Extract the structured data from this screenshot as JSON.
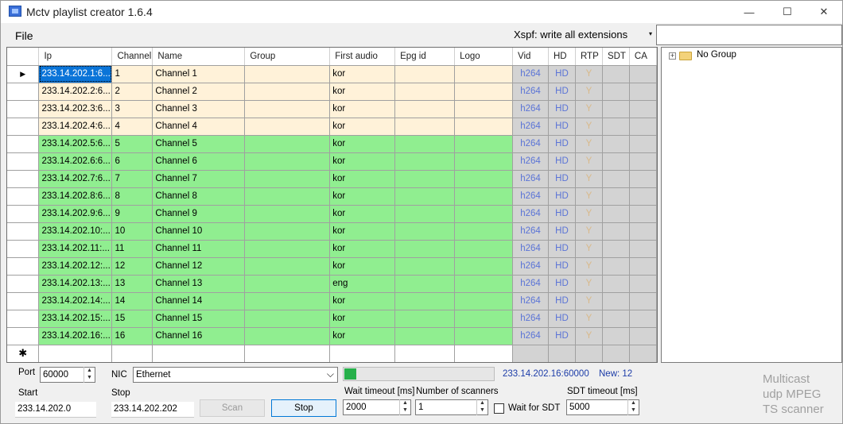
{
  "window": {
    "title": "Mctv playlist creator 1.6.4",
    "minimize_glyph": "—",
    "maximize_glyph": "☐",
    "close_glyph": "✕"
  },
  "menu": {
    "file": "File"
  },
  "toolbar": {
    "extension_option": "Xspf: write all extensions",
    "dropdown_glyph": "▾",
    "text_value": ""
  },
  "grid": {
    "columns": [
      "Ip",
      "Channel",
      "Name",
      "Group",
      "First audio",
      "Epg id",
      "Logo",
      "Vid",
      "HD",
      "RTP",
      "SDT",
      "CA"
    ],
    "current_row_marker": "▶",
    "new_row_marker": "✱",
    "rows": [
      {
        "ip": "233.14.202.1:6...",
        "channel": "1",
        "name": "Channel 1",
        "group": "",
        "audio": "kor",
        "epg": "",
        "logo": "",
        "vid": "h264",
        "hd": "HD",
        "rtp": "Y",
        "sdt": "",
        "ca": "",
        "state": "cream"
      },
      {
        "ip": "233.14.202.2:6...",
        "channel": "2",
        "name": "Channel 2",
        "group": "",
        "audio": "kor",
        "epg": "",
        "logo": "",
        "vid": "h264",
        "hd": "HD",
        "rtp": "Y",
        "sdt": "",
        "ca": "",
        "state": "cream"
      },
      {
        "ip": "233.14.202.3:6...",
        "channel": "3",
        "name": "Channel 3",
        "group": "",
        "audio": "kor",
        "epg": "",
        "logo": "",
        "vid": "h264",
        "hd": "HD",
        "rtp": "Y",
        "sdt": "",
        "ca": "",
        "state": "cream"
      },
      {
        "ip": "233.14.202.4:6...",
        "channel": "4",
        "name": "Channel 4",
        "group": "",
        "audio": "kor",
        "epg": "",
        "logo": "",
        "vid": "h264",
        "hd": "HD",
        "rtp": "Y",
        "sdt": "",
        "ca": "",
        "state": "cream"
      },
      {
        "ip": "233.14.202.5:6...",
        "channel": "5",
        "name": "Channel 5",
        "group": "",
        "audio": "kor",
        "epg": "",
        "logo": "",
        "vid": "h264",
        "hd": "HD",
        "rtp": "Y",
        "sdt": "",
        "ca": "",
        "state": "green"
      },
      {
        "ip": "233.14.202.6:6...",
        "channel": "6",
        "name": "Channel 6",
        "group": "",
        "audio": "kor",
        "epg": "",
        "logo": "",
        "vid": "h264",
        "hd": "HD",
        "rtp": "Y",
        "sdt": "",
        "ca": "",
        "state": "green"
      },
      {
        "ip": "233.14.202.7:6...",
        "channel": "7",
        "name": "Channel 7",
        "group": "",
        "audio": "kor",
        "epg": "",
        "logo": "",
        "vid": "h264",
        "hd": "HD",
        "rtp": "Y",
        "sdt": "",
        "ca": "",
        "state": "green"
      },
      {
        "ip": "233.14.202.8:6...",
        "channel": "8",
        "name": "Channel 8",
        "group": "",
        "audio": "kor",
        "epg": "",
        "logo": "",
        "vid": "h264",
        "hd": "HD",
        "rtp": "Y",
        "sdt": "",
        "ca": "",
        "state": "green"
      },
      {
        "ip": "233.14.202.9:6...",
        "channel": "9",
        "name": "Channel 9",
        "group": "",
        "audio": "kor",
        "epg": "",
        "logo": "",
        "vid": "h264",
        "hd": "HD",
        "rtp": "Y",
        "sdt": "",
        "ca": "",
        "state": "green"
      },
      {
        "ip": "233.14.202.10:...",
        "channel": "10",
        "name": "Channel 10",
        "group": "",
        "audio": "kor",
        "epg": "",
        "logo": "",
        "vid": "h264",
        "hd": "HD",
        "rtp": "Y",
        "sdt": "",
        "ca": "",
        "state": "green"
      },
      {
        "ip": "233.14.202.11:...",
        "channel": "11",
        "name": "Channel 11",
        "group": "",
        "audio": "kor",
        "epg": "",
        "logo": "",
        "vid": "h264",
        "hd": "HD",
        "rtp": "Y",
        "sdt": "",
        "ca": "",
        "state": "green"
      },
      {
        "ip": "233.14.202.12:...",
        "channel": "12",
        "name": "Channel 12",
        "group": "",
        "audio": "kor",
        "epg": "",
        "logo": "",
        "vid": "h264",
        "hd": "HD",
        "rtp": "Y",
        "sdt": "",
        "ca": "",
        "state": "green"
      },
      {
        "ip": "233.14.202.13:...",
        "channel": "13",
        "name": "Channel 13",
        "group": "",
        "audio": "eng",
        "epg": "",
        "logo": "",
        "vid": "h264",
        "hd": "HD",
        "rtp": "Y",
        "sdt": "",
        "ca": "",
        "state": "green"
      },
      {
        "ip": "233.14.202.14:...",
        "channel": "14",
        "name": "Channel 14",
        "group": "",
        "audio": "kor",
        "epg": "",
        "logo": "",
        "vid": "h264",
        "hd": "HD",
        "rtp": "Y",
        "sdt": "",
        "ca": "",
        "state": "green"
      },
      {
        "ip": "233.14.202.15:...",
        "channel": "15",
        "name": "Channel 15",
        "group": "",
        "audio": "kor",
        "epg": "",
        "logo": "",
        "vid": "h264",
        "hd": "HD",
        "rtp": "Y",
        "sdt": "",
        "ca": "",
        "state": "green"
      },
      {
        "ip": "233.14.202.16:...",
        "channel": "16",
        "name": "Channel 16",
        "group": "",
        "audio": "kor",
        "epg": "",
        "logo": "",
        "vid": "h264",
        "hd": "HD",
        "rtp": "Y",
        "sdt": "",
        "ca": "",
        "state": "green"
      }
    ]
  },
  "tree": {
    "expander": "+",
    "root_label": "No Group"
  },
  "controls": {
    "port_label": "Port",
    "port_value": "60000",
    "nic_label": "NIC",
    "nic_value": "Ethernet",
    "start_label": "Start",
    "start_value": "233.14.202.0",
    "stop_label": "Stop",
    "stop_value": "233.14.202.202",
    "scan_button": "Scan",
    "stop_button": "Stop",
    "wait_timeout_label": "Wait timeout [ms]",
    "wait_timeout_value": "2000",
    "scanners_label": "Number of scanners",
    "scanners_value": "1",
    "wait_for_sdt_label": "Wait for SDT",
    "sdt_timeout_label": "SDT timeout [ms]",
    "sdt_timeout_value": "5000",
    "spin_up": "▲",
    "spin_down": "▼",
    "dropdown_glyph": "⌵"
  },
  "status": {
    "progress_fraction": 0.08,
    "current_address": "233.14.202.16:60000",
    "new_count": "New: 12"
  },
  "brand": {
    "line1": "Multicast",
    "line2": "udp MPEG",
    "line3": "TS scanner"
  }
}
